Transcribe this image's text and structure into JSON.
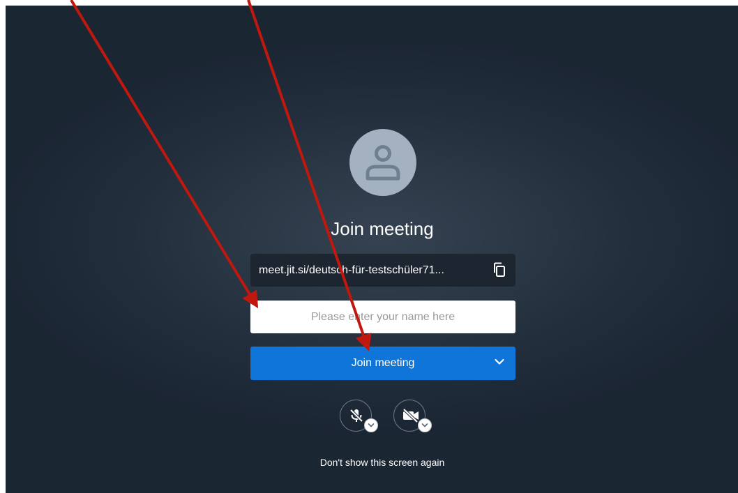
{
  "prejoin": {
    "title": "Join meeting",
    "meeting_url": "meet.jit.si/deutsch-für-testschüler71...",
    "name_placeholder": "Please enter your name here",
    "join_button_label": "Join meeting",
    "dont_show_label": "Don't show this screen again"
  },
  "icons": {
    "avatar": "user-avatar-icon",
    "copy": "copy-icon",
    "join_options": "chevron-down-icon",
    "microphone": "microphone-off-icon",
    "camera": "camera-off-icon",
    "media_options": "chevron-down-icon"
  },
  "colors": {
    "background": "#222e3c",
    "avatar": "#a4b1c0",
    "url_box": "#1c2530",
    "join_button": "#0f75d8",
    "annotation_arrow": "#c0170e"
  }
}
